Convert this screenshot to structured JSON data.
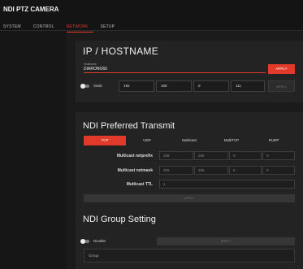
{
  "app": {
    "title": "NDI PTZ CAMERA"
  },
  "nav": [
    {
      "label": "SYSTEM"
    },
    {
      "label": "CONTROL"
    },
    {
      "label": "NETWORK"
    },
    {
      "label": "SETUP"
    }
  ],
  "accent_color": "#e23a2a",
  "hostname_section": {
    "title": "IP / HOSTNAME",
    "field_label": "Hostname",
    "hostname_value": "DIARONO60",
    "apply_label": "APPLY",
    "static_label": "Static",
    "ip_octets": [
      "192",
      "168",
      "0",
      "111"
    ],
    "ip_apply_label": "APPLY"
  },
  "transmit_section": {
    "title": "NDI Preferred Transmit",
    "protocols": [
      {
        "label": "TCP",
        "active": true
      },
      {
        "label": "UDP",
        "active": false
      },
      {
        "label": "Multicast",
        "active": false
      },
      {
        "label": "MultiTCP",
        "active": false
      },
      {
        "label": "RUDP",
        "active": false
      }
    ],
    "netprefix_label": "Multicast netprefix",
    "netprefix_values": [
      "239",
      "255",
      "0",
      "0"
    ],
    "netmask_label": "Multicast netmask",
    "netmask_values": [
      "255",
      "255",
      "0",
      "0"
    ],
    "ttl_label": "Multicast TTL",
    "ttl_value": "1",
    "apply_label": "APPLY"
  },
  "group_section": {
    "title": "NDI Group Setting",
    "disable_label": "Disable",
    "apply_label": "APPLY",
    "group_placeholder": "Group"
  }
}
